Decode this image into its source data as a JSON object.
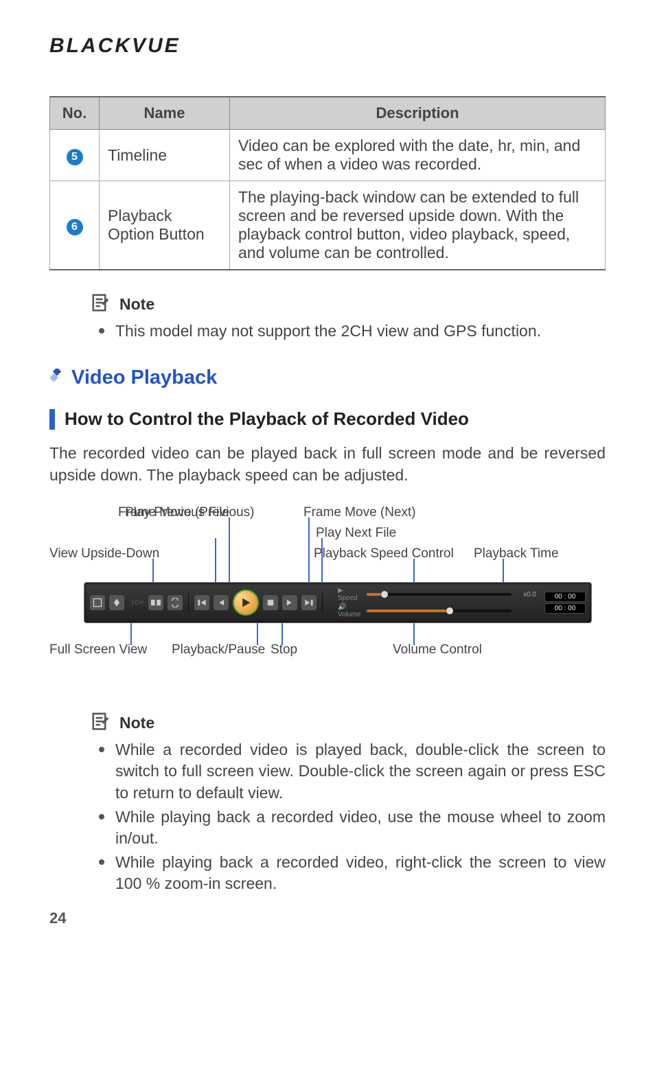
{
  "brand": "BLACKVUE",
  "table": {
    "headers": {
      "no": "No.",
      "name": "Name",
      "desc": "Description"
    },
    "rows": [
      {
        "num": "5",
        "name": "Timeline",
        "desc": "Video can be explored with the date, hr, min, and sec of when a video was recorded."
      },
      {
        "num": "6",
        "name": "Playback Option Button",
        "desc": "The playing-back window can be extended to full screen and be reversed upside down. With the playback control button, video playback, speed, and volume can be controlled."
      }
    ]
  },
  "note1": {
    "label": "Note",
    "items": [
      "This model may not support the 2CH view and GPS function."
    ]
  },
  "section_title": "Video Playback",
  "sub_title": "How to Control the Playback of Recorded Video",
  "body": "The recorded video can be played back in full screen mode and be reversed upside down. The playback speed can be adjusted.",
  "diagram": {
    "labels": {
      "frame_prev": "Frame Move (Previous)",
      "frame_next": "Frame Move (Next)",
      "play_prev_file": "Play Previous File",
      "play_next_file": "Play Next File",
      "upside_down": "View Upside-Down",
      "speed_control": "Playback Speed Control",
      "playback_time": "Playback Time",
      "fullscreen": "Full Screen View",
      "play_pause": "Playback/Pause",
      "stop": "Stop",
      "volume": "Volume Control"
    },
    "bar": {
      "ch_label": "2CH",
      "speed_label": "Speed",
      "volume_label": "Volume",
      "speed_value": "x0.0",
      "time1": "00 : 00",
      "time2": "00 : 00"
    }
  },
  "note2": {
    "label": "Note",
    "items": [
      "While a recorded video is played back, double-click the screen to switch to full screen view. Double-click the screen again or press ESC to return to default view.",
      "While playing back a recorded video, use the mouse wheel to zoom in/out.",
      "While playing back a recorded video, right-click the screen to view 100 % zoom-in screen."
    ]
  },
  "page_number": "24"
}
